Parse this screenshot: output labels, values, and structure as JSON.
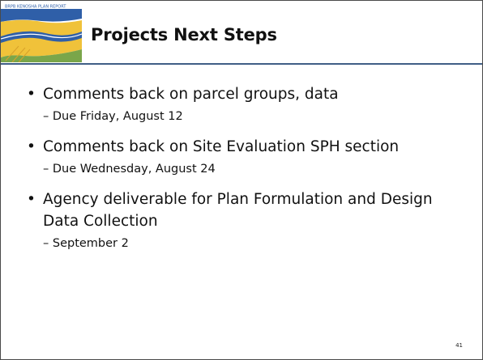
{
  "slide": {
    "title": "Projects Next Steps",
    "logo_text": "BRPB KENOSHA PLAN REPORT",
    "bullets": [
      {
        "text": "Comments back on parcel groups, data",
        "sub": "– Due Friday, August 12"
      },
      {
        "text": "Comments back on Site Evaluation SPH section",
        "sub": "– Due Wednesday,  August 24"
      },
      {
        "text": "Agency deliverable for Plan Formulation and Design Data Collection",
        "sub": "– September 2"
      }
    ],
    "page_number": "41"
  },
  "colors": {
    "rule": "#3f5e86",
    "logo_blue": "#2f5fa8",
    "logo_yellow": "#f0c23a"
  }
}
